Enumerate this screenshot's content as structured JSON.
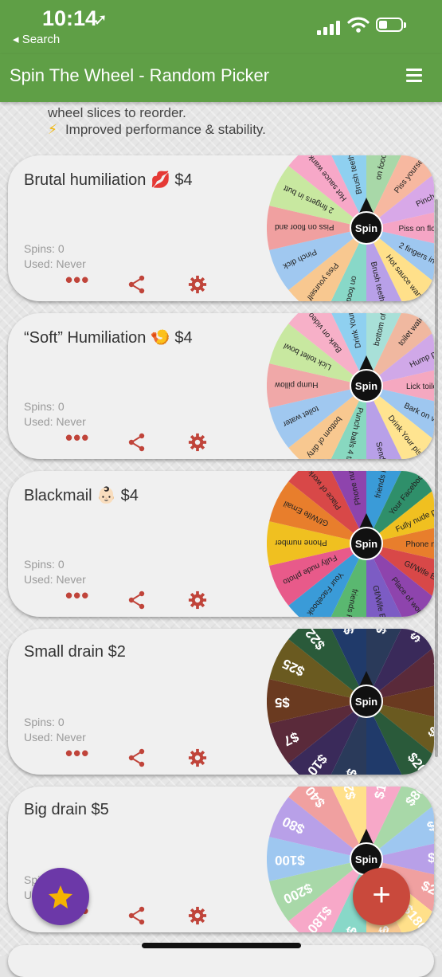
{
  "status": {
    "time": "10:14",
    "back_label": "◂ Search"
  },
  "appbar": {
    "title": "Spin The Wheel - Random Picker"
  },
  "notes": {
    "line1": "wheel slices to reorder.",
    "line2": "Improved performance & stability."
  },
  "labels": {
    "spins_prefix": "Spins: ",
    "used_prefix": "Used: ",
    "spin_button": "Spin"
  },
  "cards": [
    {
      "title": "Brutal humiliation 💋 $4",
      "spins": "0",
      "used": "Never",
      "wheel": {
        "type": "text",
        "colors": [
          "#a8d8a8",
          "#f7b8a0",
          "#d8a8e8",
          "#f5a5c5",
          "#9ec7f0",
          "#ffe08a",
          "#b8a0e8",
          "#88d8c8",
          "#f8c890",
          "#a0c8f0",
          "#f0a0a0",
          "#c8e8a0",
          "#f7a8c8",
          "#8fd0f0"
        ],
        "slices": [
          "on food and",
          "Piss yourself",
          "Pinch dick",
          "Piss on floor and",
          "2 fingers in butt",
          "Hot sauce wank",
          "Brush teeth with",
          "on food and",
          "Piss yourself",
          "Pinch dick",
          "Piss on floor and",
          "2 fingers in butt",
          "Hot sauce wank",
          "Brush teeth with"
        ]
      }
    },
    {
      "title": "“Soft” Humiliation 🍤 $4",
      "spins": "0",
      "used": "Never",
      "wheel": {
        "type": "text",
        "colors": [
          "#a8e0d8",
          "#f0b8a0",
          "#d0a8e8",
          "#f5a8c0",
          "#9ec7f0",
          "#ffe490",
          "#b8a0e8",
          "#88d8c0",
          "#f8c890",
          "#a0c8f0",
          "#f0a8a8",
          "#c8e8a0",
          "#f7b0c8",
          "#8fd0f0"
        ],
        "slices": [
          "bottom of dirty",
          "toilet water",
          "Hump pillow",
          "Lick toilet bowl",
          "Bark on video",
          "Drink Your piss",
          "Send $50",
          "Punch balls 4 times",
          "bottom of dirty",
          "toilet water",
          "Hump pillow",
          "Lick toilet bowl",
          "Bark on video",
          "Drink Your piss"
        ]
      }
    },
    {
      "title": "Blackmail 👶🏻 $4",
      "spins": "0",
      "used": "Never",
      "wheel": {
        "type": "text",
        "colors": [
          "#3a9bd8",
          "#2f8f6a",
          "#f0c020",
          "#e87e2c",
          "#d84848",
          "#8e44ad",
          "#7c5cc4",
          "#5ab870",
          "#3a9bd8",
          "#e85a8a",
          "#f0c020",
          "#e87e2c",
          "#d84848",
          "#8e44ad"
        ],
        "slices": [
          "friends Fb or",
          "Your Facebook",
          "Fully nude photo",
          "Phone number",
          "Gf/Wife Email",
          "Place of work",
          "Gf/Wife Email",
          "friends Fb or",
          "Your Facebook",
          "Fully nude photo",
          "Phone number",
          "Gf/Wife Email",
          "Place of work",
          "Phone number"
        ]
      }
    },
    {
      "title": "Small drain $2",
      "spins": "0",
      "used": "Never",
      "wheel": {
        "type": "money",
        "colors": [
          "#2a3a5a",
          "#3a2a5a",
          "#5a2a3a",
          "#6a3a20",
          "#6a5a20",
          "#2a5a3a",
          "#203a6a",
          "#2a3a5a",
          "#3a2a5a",
          "#5a2a3a",
          "#6a3a20",
          "#6a5a20",
          "#2a5a3a",
          "#203a6a"
        ],
        "slices": [
          "$10",
          "$7",
          "$5",
          "$25",
          "$22",
          "$20",
          "$8",
          "$20",
          "$10",
          "$7",
          "$5",
          "$25",
          "$22",
          "$20"
        ]
      }
    },
    {
      "title": "Big drain $5",
      "spins": "0",
      "used": "Never",
      "wheel": {
        "type": "money",
        "colors": [
          "#f7a8c8",
          "#a8d8a8",
          "#9ec7f0",
          "#b8a0e8",
          "#f0a0a0",
          "#ffe08a",
          "#f8c890",
          "#88d8c8",
          "#f7a8c8",
          "#a8d8a8",
          "#9ec7f0",
          "#b8a0e8",
          "#f0a0a0",
          "#ffe08a"
        ],
        "slices": [
          "$100",
          "$80",
          "$40",
          "$250",
          "$200",
          "$180",
          "$20",
          "$50",
          "$180",
          "$200",
          "$100",
          "$80",
          "$40",
          "$250"
        ]
      }
    }
  ]
}
